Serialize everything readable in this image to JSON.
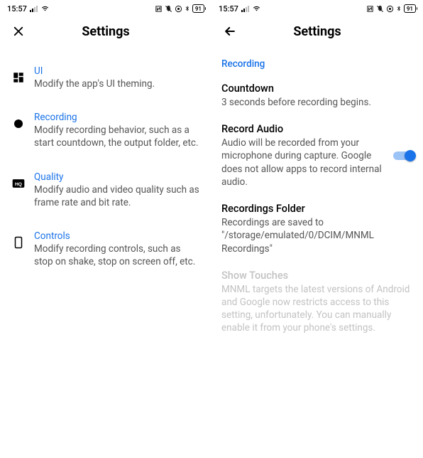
{
  "statusbar": {
    "time": "15:57",
    "battery": "91"
  },
  "left": {
    "header_title": "Settings",
    "items": [
      {
        "title": "UI",
        "desc": "Modify the app's UI theming."
      },
      {
        "title": "Recording",
        "desc": "Modify recording behavior, such as a start countdown, the output folder, etc."
      },
      {
        "title": "Quality",
        "desc": "Modify audio and video quality such as frame rate and bit rate."
      },
      {
        "title": "Controls",
        "desc": "Modify recording controls, such as stop on shake, stop on screen off, etc."
      }
    ]
  },
  "right": {
    "header_title": "Settings",
    "section_heading": "Recording",
    "items": [
      {
        "title": "Countdown",
        "desc": "3 seconds before recording begins."
      },
      {
        "title": "Record Audio",
        "desc": "Audio will be recorded from your microphone during capture. Google does not allow apps to record internal audio."
      },
      {
        "title": "Recordings Folder",
        "desc": "Recordings are saved to \"/storage/emulated/0/DCIM/MNML Recordings\""
      },
      {
        "title": "Show Touches",
        "desc": "MNML targets the latest versions of Android and Google now restricts access to this setting, unfortunately. You can manually enable it from your phone's settings."
      }
    ]
  }
}
